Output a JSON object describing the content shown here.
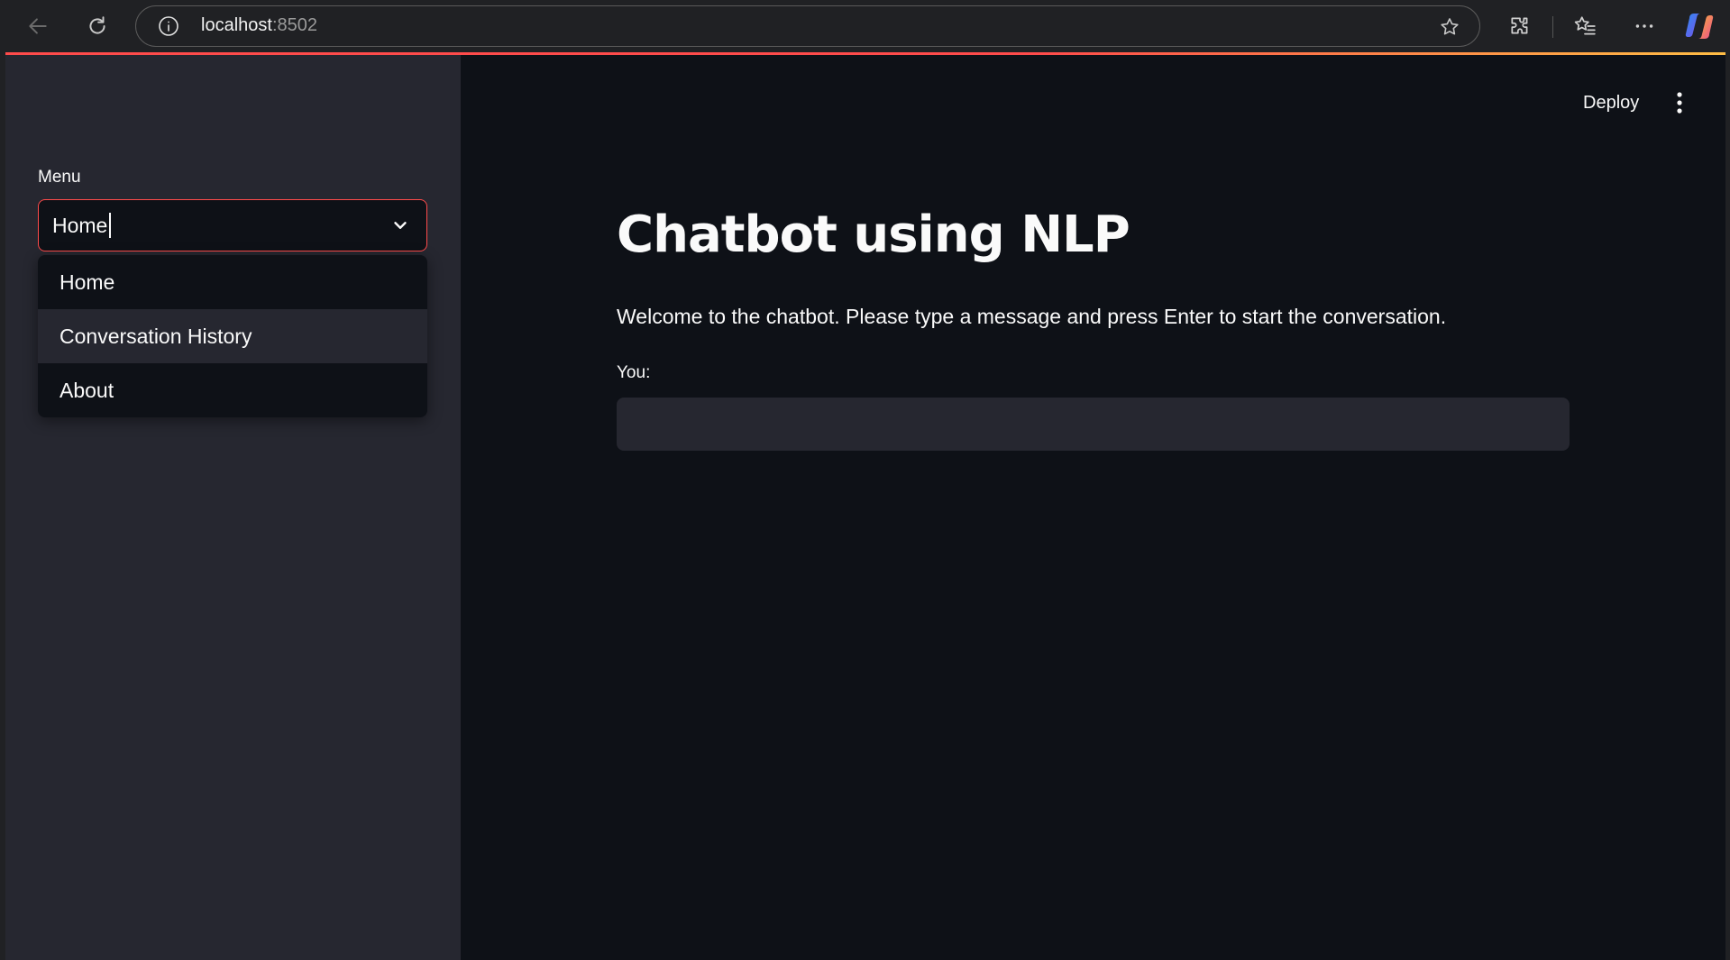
{
  "browser": {
    "url_host": "localhost",
    "url_port": ":8502",
    "icons": [
      "back-icon",
      "reload-icon",
      "site-info-icon",
      "favorite-star-icon",
      "extensions-icon",
      "favorites-icon",
      "more-icon",
      "copilot-icon"
    ]
  },
  "sidebar": {
    "menu_label": "Menu",
    "select_value": "Home",
    "options": [
      {
        "label": "Home",
        "highlighted": false
      },
      {
        "label": "Conversation History",
        "highlighted": true
      },
      {
        "label": "About",
        "highlighted": false
      }
    ]
  },
  "header": {
    "deploy_label": "Deploy"
  },
  "main": {
    "title": "Chatbot using NLP",
    "welcome": "Welcome to the chatbot. Please type a message and press Enter to start the conversation.",
    "input_label": "You:",
    "input_value": ""
  },
  "colors": {
    "app_bg": "#0e1117",
    "sidebar_bg": "#262730",
    "accent": "#ff4b4b",
    "text": "#fafafa"
  }
}
